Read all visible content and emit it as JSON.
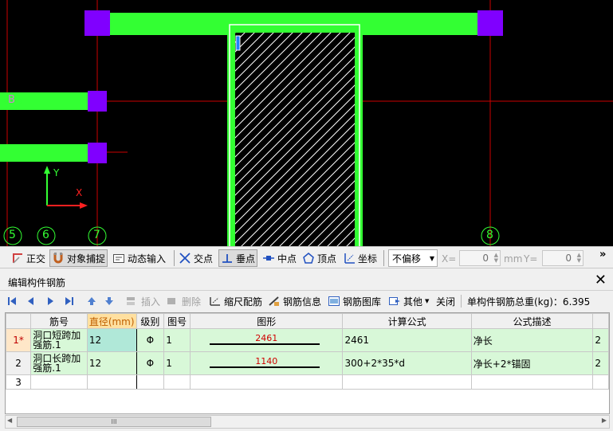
{
  "canvas": {
    "axis_labels": [
      "5",
      "6",
      "7",
      "8"
    ],
    "row_label": "B",
    "ucs": {
      "x": "X",
      "y": "Y"
    }
  },
  "snapbar": {
    "ortho": "正交",
    "object_snap": "对象捕捉",
    "dynamic_input": "动态输入",
    "intersection": "交点",
    "perpendicular": "垂点",
    "midpoint": "中点",
    "vertex": "顶点",
    "coordinate": "坐标",
    "offset_mode": "不偏移",
    "x_label": "X=",
    "x_value": "0",
    "unit": "mm",
    "y_label": "Y=",
    "y_value": "0",
    "more": "»"
  },
  "panel": {
    "title": "编辑构件钢筋",
    "close": "✕"
  },
  "rebar_toolbar": {
    "insert": "插入",
    "delete": "删除",
    "scale_rebar": "缩尺配筋",
    "rebar_info": "钢筋信息",
    "rebar_library": "钢筋图库",
    "other": "其他",
    "close": "关闭",
    "total_weight": "单构件钢筋总重(kg)：6.395"
  },
  "table": {
    "headers": [
      "",
      "筋号",
      "直径(mm)",
      "级别",
      "图号",
      "图形",
      "计算公式",
      "公式描述",
      ""
    ],
    "rows": [
      {
        "index": "1*",
        "name": "洞口短跨加强筋.1",
        "diameter": "12",
        "grade": "Φ",
        "fig": "1",
        "shape_value": "2461",
        "formula": "2461",
        "desc": "净长",
        "extra": "2"
      },
      {
        "index": "2",
        "name": "洞口长跨加强筋.1",
        "diameter": "12",
        "grade": "Φ",
        "fig": "1",
        "shape_value": "1140",
        "formula": "300+2*35*d",
        "desc": "净长+2*锚固",
        "extra": "2"
      },
      {
        "index": "3",
        "name": "",
        "diameter": "",
        "grade": "",
        "fig": "",
        "shape_value": "",
        "formula": "",
        "desc": "",
        "extra": ""
      }
    ]
  },
  "scrollbar": {
    "grip": "III"
  },
  "colors": {
    "beam": "#33ff33",
    "column": "#8000ff",
    "axis": "#cc0000",
    "grid_green": "#d8f8d8"
  }
}
